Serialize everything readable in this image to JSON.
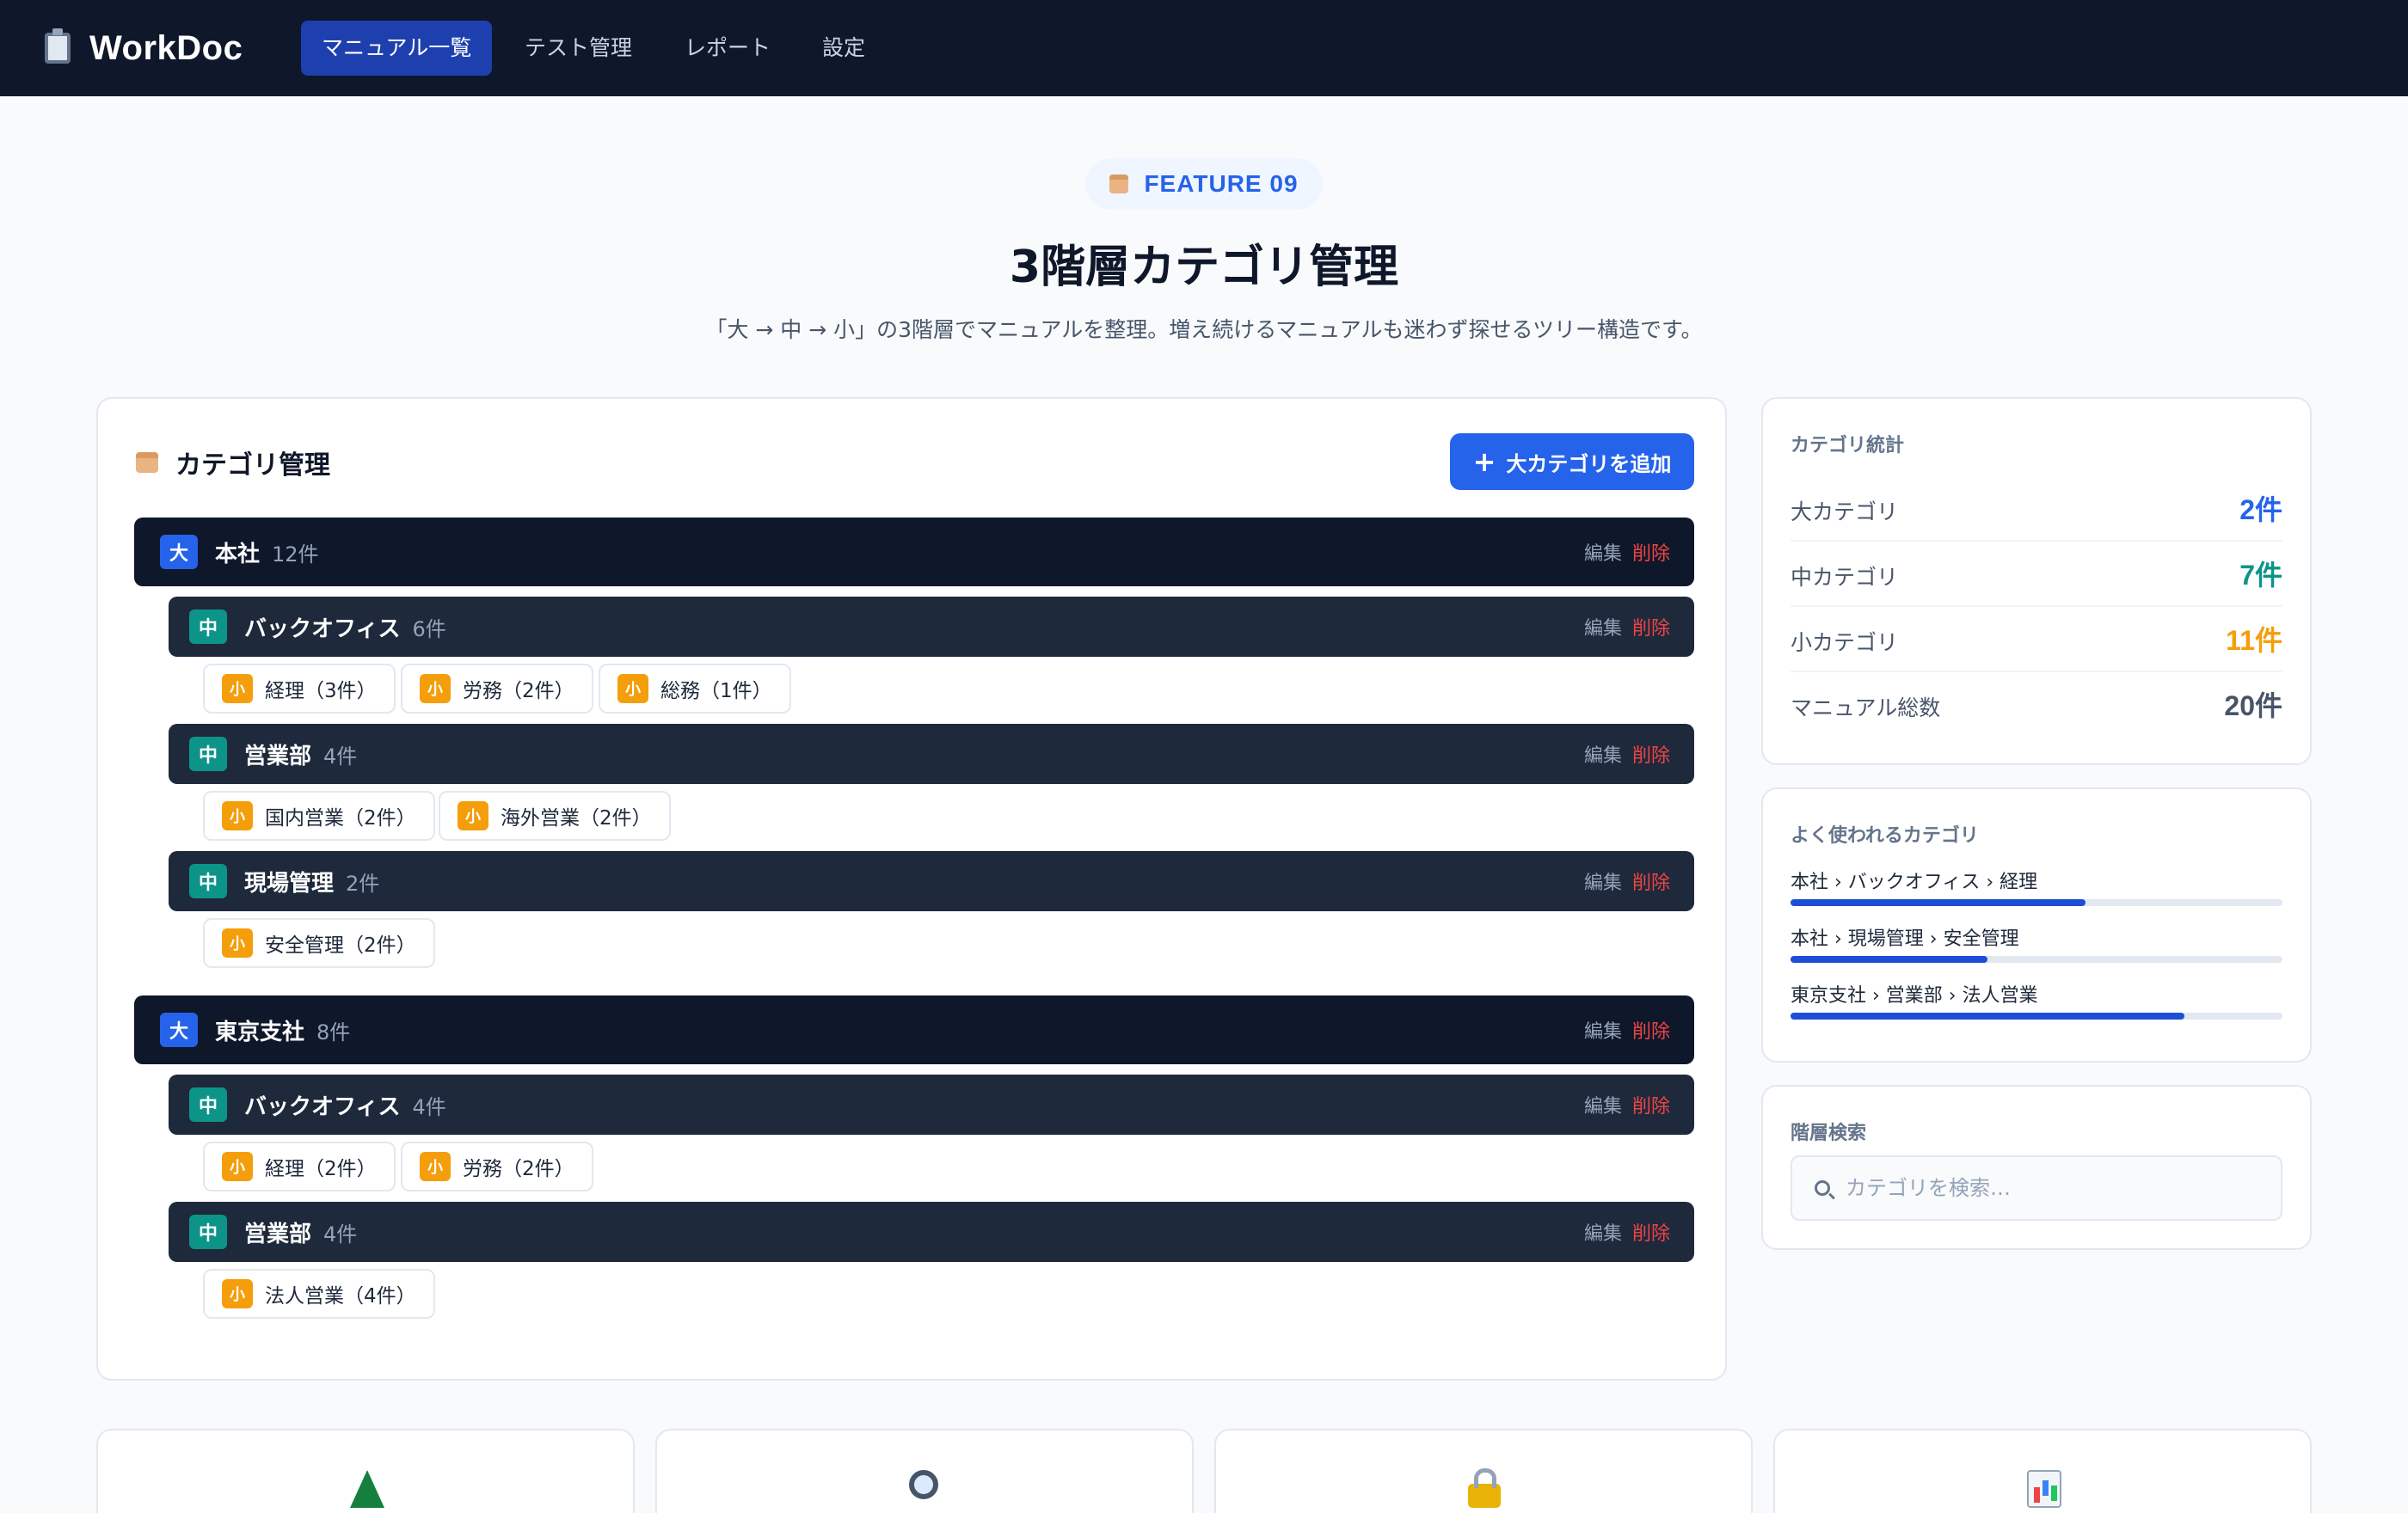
{
  "app": {
    "name": "WorkDoc",
    "nav": [
      {
        "label": "マニュアル一覧",
        "active": true
      },
      {
        "label": "テスト管理",
        "active": false
      },
      {
        "label": "レポート",
        "active": false
      },
      {
        "label": "設定",
        "active": false
      }
    ]
  },
  "hero": {
    "badge": "FEATURE 09",
    "title": "3階層カテゴリ管理",
    "subtitle": "「大 → 中 → 小」の3階層でマニュアルを整理。増え続けるマニュアルも迷わず探せるツリー構造です。"
  },
  "category_panel": {
    "title": "カテゴリ管理",
    "add_button": "大カテゴリを追加",
    "add_icon": "+",
    "edit_label": "編集",
    "delete_label": "削除",
    "level_badges": {
      "l1": "大",
      "l2": "中",
      "l3": "小"
    },
    "tree": [
      {
        "name": "本社",
        "count": "12件",
        "children": [
          {
            "name": "バックオフィス",
            "count": "6件",
            "children": [
              "経理（3件）",
              "労務（2件）",
              "総務（1件）"
            ]
          },
          {
            "name": "営業部",
            "count": "4件",
            "children": [
              "国内営業（2件）",
              "海外営業（2件）"
            ]
          },
          {
            "name": "現場管理",
            "count": "2件",
            "children": [
              "安全管理（2件）"
            ]
          }
        ]
      },
      {
        "name": "東京支社",
        "count": "8件",
        "children": [
          {
            "name": "バックオフィス",
            "count": "4件",
            "children": [
              "経理（2件）",
              "労務（2件）"
            ]
          },
          {
            "name": "営業部",
            "count": "4件",
            "children": [
              "法人営業（4件）"
            ]
          }
        ]
      }
    ]
  },
  "stats": {
    "title": "カテゴリ統計",
    "rows": [
      {
        "label": "大カテゴリ",
        "value": "2件",
        "color": "#2563eb"
      },
      {
        "label": "中カテゴリ",
        "value": "7件",
        "color": "#0d9488"
      },
      {
        "label": "小カテゴリ",
        "value": "11件",
        "color": "#f59e0b"
      },
      {
        "label": "マニュアル総数",
        "value": "20件",
        "color": "#475569"
      }
    ]
  },
  "frequent": {
    "title": "よく使われるカテゴリ",
    "items": [
      {
        "path": "本社 › バックオフィス › 経理",
        "ratio": 0.6
      },
      {
        "path": "本社 › 現場管理 › 安全管理",
        "ratio": 0.4
      },
      {
        "path": "東京支社 › 営業部 › 法人営業",
        "ratio": 0.8
      }
    ]
  },
  "search": {
    "title": "階層検索",
    "placeholder": "カテゴリを検索…"
  },
  "features": [
    {
      "icon": "tree-icon"
    },
    {
      "icon": "magnifier-icon"
    },
    {
      "icon": "lock-icon"
    },
    {
      "icon": "bar-chart-icon"
    }
  ],
  "colors": {
    "nav_bg": "#0f172a",
    "accent": "#2563eb",
    "l1_row": "#0f172a",
    "l2_row": "#1e293b",
    "l2_badge": "#0d9488",
    "l3_badge": "#f59e0b",
    "delete": "#ef4444"
  }
}
